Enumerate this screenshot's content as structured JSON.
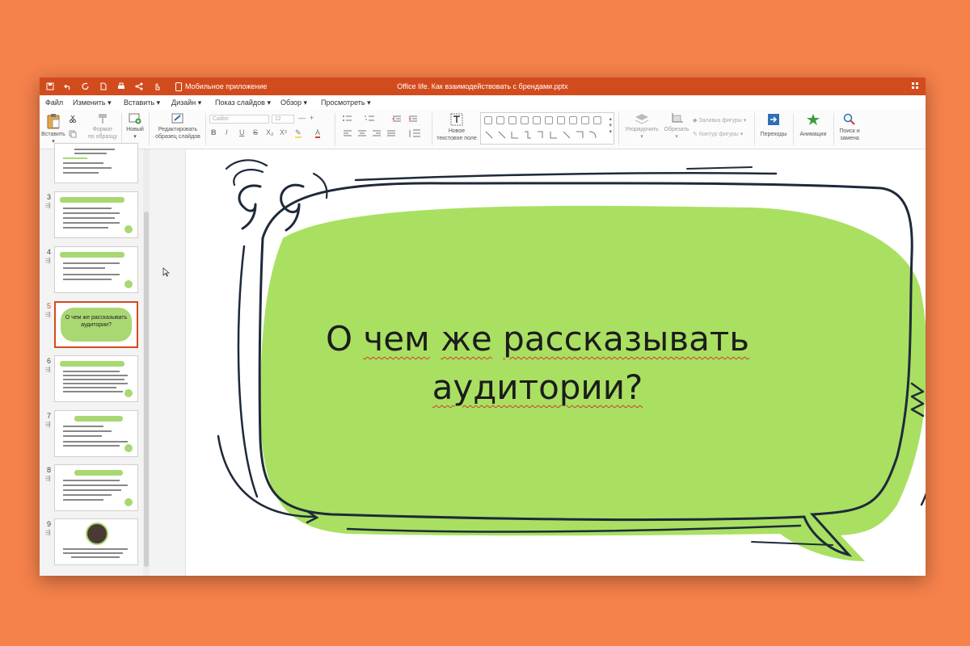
{
  "window": {
    "title": "Office life. Как взаимодействовать с брендами.pptx",
    "mobile_app_label": "Мобильное приложение"
  },
  "menu": [
    "Файл",
    "Изменить",
    "Вставить",
    "Дизайн",
    "Показ слайдов",
    "Обзор",
    "Просмотреть"
  ],
  "ribbon": {
    "paste": "Вставить",
    "format_painter_line1": "Формат",
    "format_painter_line2": "по образцу",
    "new_slide": "Новый",
    "edit_master_line1": "Редактировать",
    "edit_master_line2": "образец слайдов",
    "font_name": "Calibri",
    "font_size": "12",
    "textbox_line1": "Новое",
    "textbox_line2": "текстовое поле",
    "arrange": "Упорядочить",
    "crop": "Обрезать",
    "shape_fill": "Заливка фигуры",
    "shape_outline": "Контур фигуры",
    "transitions": "Переходы",
    "animations": "Анимации",
    "find_line1": "Поиск и",
    "find_line2": "замена"
  },
  "thumbnails": [
    {
      "number": "3"
    },
    {
      "number": "4"
    },
    {
      "number": "5",
      "selected": true,
      "text": "О чем же рассказывать аудитории?"
    },
    {
      "number": "6"
    },
    {
      "number": "7"
    },
    {
      "number": "8"
    },
    {
      "number": "9"
    }
  ],
  "slide": {
    "words": [
      "О",
      "чем",
      "же",
      "рассказывать",
      "аудитории?"
    ],
    "bubble_color": "#a9e062"
  },
  "colors": {
    "background": "#f5814b",
    "titlebar": "#d24b1d",
    "accent_green": "#a9e062"
  }
}
